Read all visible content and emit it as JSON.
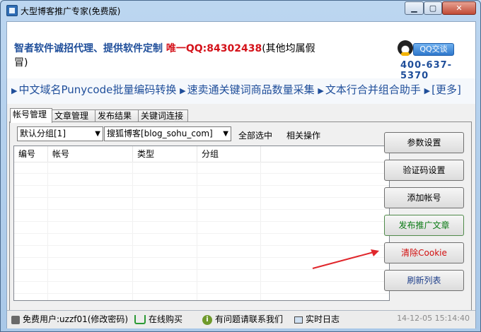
{
  "window": {
    "title": "大型博客推广专家(免费版)"
  },
  "banner": {
    "promo_text": "智者软件诚招代理、提供软件定制",
    "qq_prefix": "唯一QQ:",
    "qq_number": "84302438",
    "qq_suffix": "(其他均属假冒)",
    "qq_button_label": "QQ交谈",
    "phone": "400-637-5370"
  },
  "links": [
    "中文域名Punycode批量编码转换",
    "速卖通关键词商品数量采集",
    "文本行合并组合助手",
    "[更多]"
  ],
  "tabs": [
    {
      "label": "帐号管理",
      "active": true
    },
    {
      "label": "文章管理",
      "active": false
    },
    {
      "label": "发布结果",
      "active": false
    },
    {
      "label": "关键词连接",
      "active": false
    }
  ],
  "toolbar": {
    "group_select": "默认分组[1]",
    "blog_select": "搜狐博客[blog_sohu_com]",
    "select_all": "全部选中",
    "related_ops": "相关操作"
  },
  "grid": {
    "columns": [
      "编号",
      "帐号",
      "类型",
      "分组"
    ],
    "rows": []
  },
  "side_buttons": {
    "params": "参数设置",
    "captcha": "验证码设置",
    "add_account": "添加帐号",
    "publish": "发布推广文章",
    "clear_cookie": "清除Cookie",
    "refresh": "刷新列表"
  },
  "statusbar": {
    "user": "免费用户:uzzf01(修改密码)",
    "buy": "在线购买",
    "contact": "有问题请联系我们",
    "log": "实时日志",
    "time": "14-12-05 15:14:40"
  },
  "colors": {
    "accent_blue": "#1f4e9a",
    "qq_red": "#d4121a",
    "publish_green": "#0a7a14",
    "cookie_red": "#d10f0f"
  }
}
